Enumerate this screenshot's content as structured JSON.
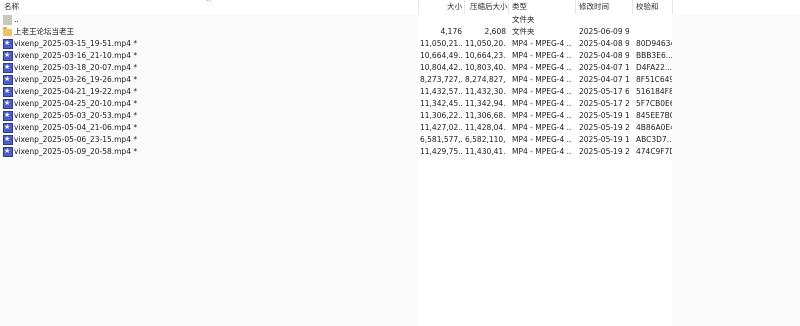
{
  "columns": {
    "name": "名称",
    "size": "大小",
    "packed": "压缩后大小",
    "type": "类型",
    "modified": "修改时间",
    "crc": "校验和"
  },
  "sort_indicator": "^",
  "rows": [
    {
      "name": "..",
      "size": "",
      "packed": "",
      "type": "文件夹",
      "modified": "",
      "crc": "",
      "icon": "up-folder-icon"
    },
    {
      "name": "上老王论坛当老王",
      "size": "4,176",
      "packed": "2,608",
      "type": "文件夹",
      "modified": "2025-06-09 9...",
      "crc": "",
      "icon": "folder-icon"
    },
    {
      "name": "vixenp_2025-03-15_19-51.mp4 *",
      "size": "11,050,21...",
      "packed": "11,050,20...",
      "type": "MP4 - MPEG-4 ...",
      "modified": "2025-04-08 9...",
      "crc": "80D94634",
      "icon": "video-file-icon"
    },
    {
      "name": "vixenp_2025-03-16_21-10.mp4 *",
      "size": "10,664,49...",
      "packed": "10,664,23...",
      "type": "MP4 - MPEG-4 ...",
      "modified": "2025-04-08 9...",
      "crc": "BBB3E6...",
      "icon": "video-file-icon"
    },
    {
      "name": "vixenp_2025-03-18_20-07.mp4 *",
      "size": "10,804,42...",
      "packed": "10,803,40...",
      "type": "MP4 - MPEG-4 ...",
      "modified": "2025-04-07 1...",
      "crc": "D4FA22...",
      "icon": "video-file-icon"
    },
    {
      "name": "vixenp_2025-03-26_19-26.mp4 *",
      "size": "8,273,727,...",
      "packed": "8,274,827,...",
      "type": "MP4 - MPEG-4 ...",
      "modified": "2025-04-07 1...",
      "crc": "8F51C649",
      "icon": "video-file-icon"
    },
    {
      "name": "vixenp_2025-04-21_19-22.mp4 *",
      "size": "11,432,57...",
      "packed": "11,432,30...",
      "type": "MP4 - MPEG-4 ...",
      "modified": "2025-05-17 6...",
      "crc": "516184F8",
      "icon": "video-file-icon"
    },
    {
      "name": "vixenp_2025-04-25_20-10.mp4 *",
      "size": "11,342,45...",
      "packed": "11,342,94...",
      "type": "MP4 - MPEG-4 ...",
      "modified": "2025-05-17 2...",
      "crc": "5F7CB0E6",
      "icon": "video-file-icon"
    },
    {
      "name": "vixenp_2025-05-03_20-53.mp4 *",
      "size": "11,306,22...",
      "packed": "11,306,68...",
      "type": "MP4 - MPEG-4 ...",
      "modified": "2025-05-19 1...",
      "crc": "845EE7BC",
      "icon": "video-file-icon"
    },
    {
      "name": "vixenp_2025-05-04_21-06.mp4 *",
      "size": "11,427,02...",
      "packed": "11,428,04...",
      "type": "MP4 - MPEG-4 ...",
      "modified": "2025-05-19 2...",
      "crc": "4B86A0E4",
      "icon": "video-file-icon"
    },
    {
      "name": "vixenp_2025-05-06_23-15.mp4 *",
      "size": "6,581,577,...",
      "packed": "6,582,110,...",
      "type": "MP4 - MPEG-4 ...",
      "modified": "2025-05-19 1...",
      "crc": "ABC3D7...",
      "icon": "video-file-icon"
    },
    {
      "name": "vixenp_2025-05-09_20-58.mp4 *",
      "size": "11,429,75...",
      "packed": "11,430,41...",
      "type": "MP4 - MPEG-4 ...",
      "modified": "2025-05-19 2...",
      "crc": "474C9F7D",
      "icon": "video-file-icon"
    }
  ],
  "colors": {
    "folder": "#e9c56a",
    "video_icon": "#4d5fc6"
  }
}
